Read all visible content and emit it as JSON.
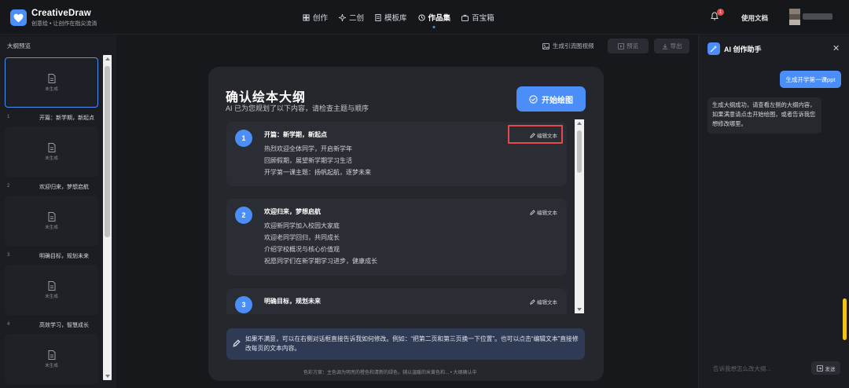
{
  "brand": {
    "name": "CreativeDraw",
    "tagline": "创意绘 • 让创作在指尖流淌"
  },
  "nav": [
    {
      "label": "创作",
      "icon": "grid-icon"
    },
    {
      "label": "二创",
      "icon": "sparkle-icon"
    },
    {
      "label": "模板库",
      "icon": "document-icon"
    },
    {
      "label": "作品集",
      "icon": "history-icon",
      "active": true
    },
    {
      "label": "百宝箱",
      "icon": "toolbox-icon"
    }
  ],
  "header": {
    "notification_count": "1",
    "docs_label": "使用文档"
  },
  "outline": {
    "title": "大纲预览",
    "thumb_label": "未生成",
    "pages": [
      {
        "num": "1",
        "title": "开篇：新学期，新起点"
      },
      {
        "num": "2",
        "title": "欢迎归来，梦想启航"
      },
      {
        "num": "3",
        "title": "明确目标，规划未来"
      },
      {
        "num": "4",
        "title": "高效学习，智慧成长"
      }
    ]
  },
  "toolbar": {
    "gen_video": "生成引流图视频",
    "preview": "预览",
    "export": "导出"
  },
  "card": {
    "title": "确认绘本大纲",
    "subtitle": "AI 已为您规划了以下内容，请检查主题与顺序",
    "start_button": "开始绘图",
    "edit_label": "编辑文本",
    "sections": [
      {
        "num": "1",
        "title": "开篇：新学期，新起点",
        "lines": [
          "热烈欢迎全体同学，开启新学年",
          "回顾假期，展望新学期学习生活",
          "开学第一课主题：扬帆起航，逐梦未来"
        ]
      },
      {
        "num": "2",
        "title": "欢迎归来，梦想启航",
        "lines": [
          "欢迎新同学加入校园大家庭",
          "欢迎老同学回归，共同成长",
          "介绍学校概况与核心价值观",
          "祝愿同学们在新学期学习进步，健康成长"
        ]
      },
      {
        "num": "3",
        "title": "明确目标，规划未来",
        "lines": []
      }
    ],
    "tip": "如果不满意，可以在右侧对话框直接告诉我如何修改。例如：“把第二页和第三页换一下位置”。也可以点击“编辑文本”直接修改每页的文本内容。",
    "footer": "色彩方案：主色调为明亮的橙色和清新的绿色，辅以温暖的米黄色和...",
    "footer_status": "大纲确认中"
  },
  "assistant": {
    "title": "AI 创作助手",
    "user_message": "生成开学第一课ppt",
    "ai_message": "生成大纲成功，请查看左侧的大纲内容，如果满意请点击开始绘图，或者告诉我您想修改哪里。",
    "input_placeholder": "告诉我想怎么改大纲...",
    "send_label": "发送"
  },
  "colors": {
    "accent": "#4b8ef7",
    "highlight": "#e5484d",
    "background": "#17181c"
  }
}
